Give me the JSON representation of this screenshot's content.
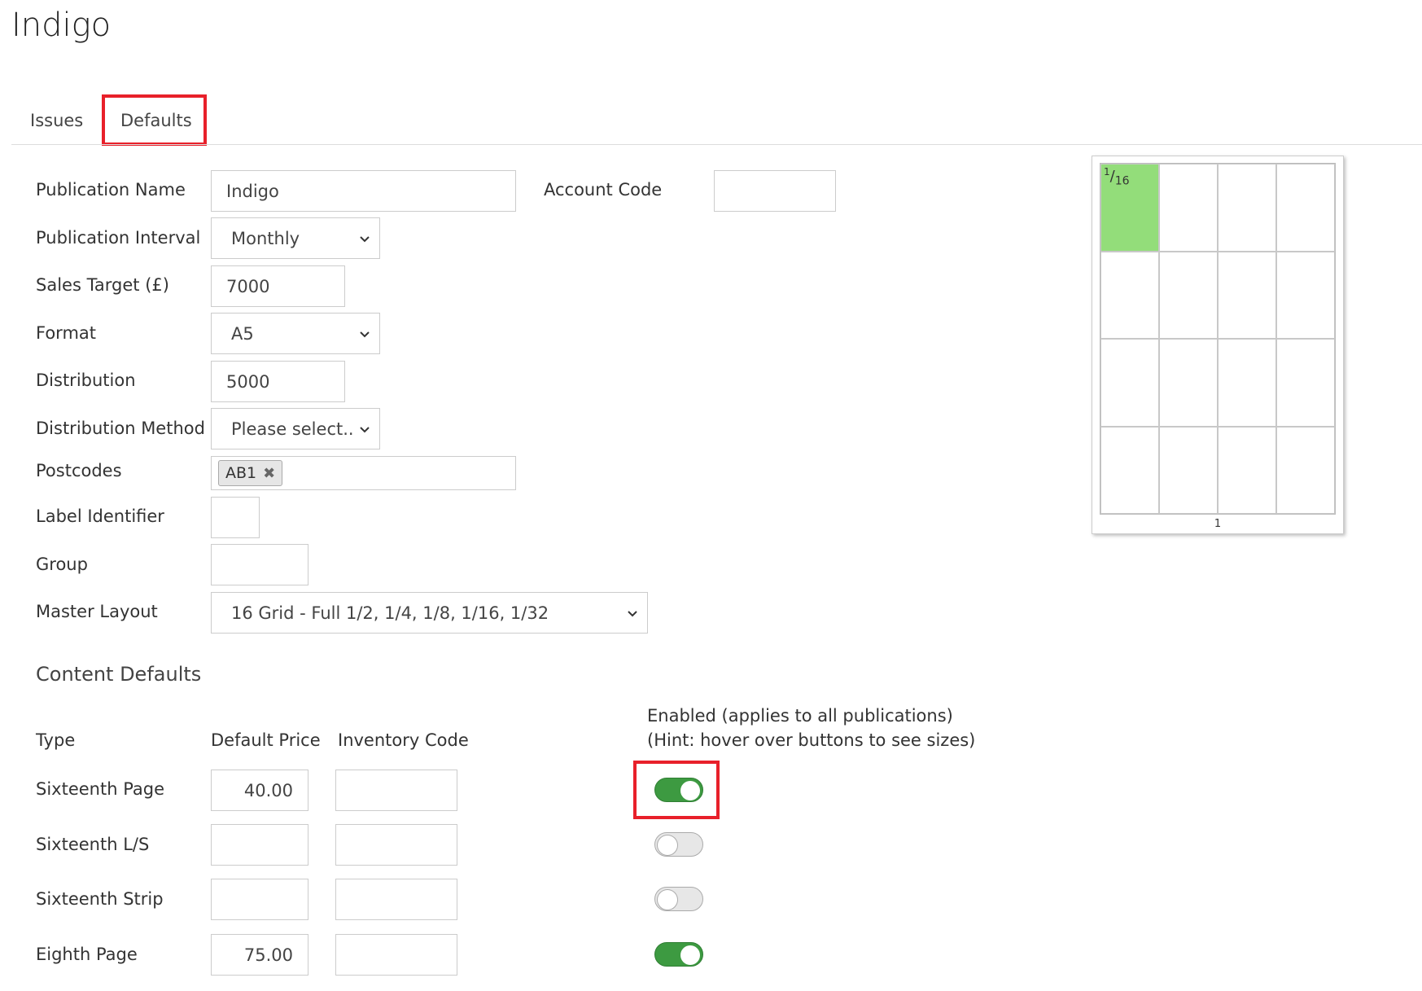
{
  "page": {
    "title": "Indigo"
  },
  "tabs": [
    {
      "label": "Issues",
      "active": false
    },
    {
      "label": "Defaults",
      "active": true,
      "highlighted": true
    }
  ],
  "form": {
    "publication_name": {
      "label": "Publication Name",
      "value": "Indigo"
    },
    "account_code": {
      "label": "Account Code",
      "value": ""
    },
    "publication_interval": {
      "label": "Publication Interval",
      "value": "Monthly"
    },
    "sales_target": {
      "label": "Sales Target (£)",
      "value": "7000"
    },
    "format": {
      "label": "Format",
      "value": "A5"
    },
    "distribution": {
      "label": "Distribution",
      "value": "5000"
    },
    "distribution_method": {
      "label": "Distribution Method",
      "value": "Please select.."
    },
    "postcodes": {
      "label": "Postcodes",
      "tags": [
        "AB1"
      ],
      "remove_glyph": "✖"
    },
    "label_identifier": {
      "label": "Label Identifier",
      "value": ""
    },
    "group": {
      "label": "Group",
      "value": ""
    },
    "master_layout": {
      "label": "Master Layout",
      "value": "16 Grid - Full 1/2, 1/4, 1/8, 1/16, 1/32"
    }
  },
  "content_defaults": {
    "title": "Content Defaults",
    "headers": {
      "type": "Type",
      "price": "Default Price",
      "inventory": "Inventory Code",
      "enabled_line1": "Enabled (applies to all publications)",
      "enabled_line2": "(Hint: hover over buttons to see sizes)"
    },
    "rows": [
      {
        "type": "Sixteenth Page",
        "price": "40.00",
        "inventory": "",
        "enabled": true,
        "highlighted": true
      },
      {
        "type": "Sixteenth L/S",
        "price": "",
        "inventory": "",
        "enabled": false
      },
      {
        "type": "Sixteenth Strip",
        "price": "",
        "inventory": "",
        "enabled": false
      },
      {
        "type": "Eighth Page",
        "price": "75.00",
        "inventory": "",
        "enabled": true
      }
    ]
  },
  "layout_preview": {
    "fraction_num": "1",
    "fraction_den": "16",
    "page_number": "1",
    "fill_color": "#93dd7a"
  },
  "colors": {
    "highlight": "#e8202a",
    "toggle_on": "#3d9a41",
    "toggle_off": "#e7e7e7"
  }
}
